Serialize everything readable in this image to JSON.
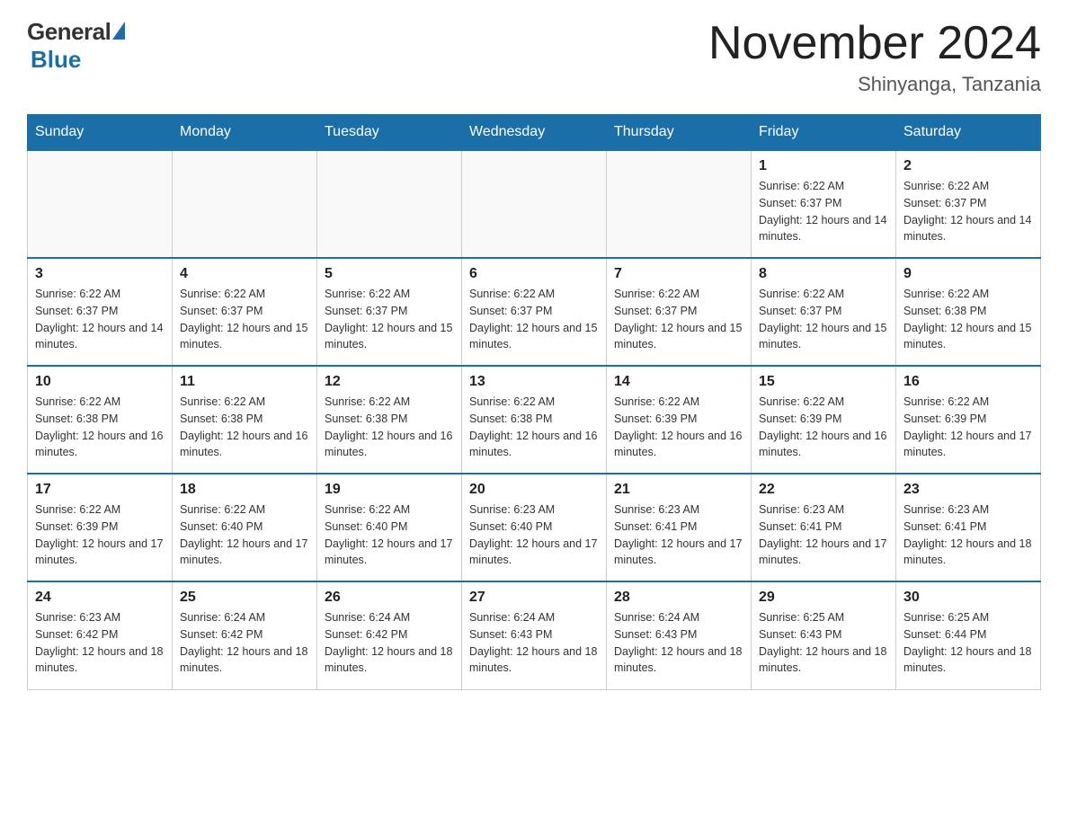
{
  "logo": {
    "general": "General",
    "blue": "Blue"
  },
  "title": {
    "month_year": "November 2024",
    "location": "Shinyanga, Tanzania"
  },
  "days_of_week": [
    "Sunday",
    "Monday",
    "Tuesday",
    "Wednesday",
    "Thursday",
    "Friday",
    "Saturday"
  ],
  "weeks": [
    [
      {
        "day": "",
        "info": ""
      },
      {
        "day": "",
        "info": ""
      },
      {
        "day": "",
        "info": ""
      },
      {
        "day": "",
        "info": ""
      },
      {
        "day": "",
        "info": ""
      },
      {
        "day": "1",
        "info": "Sunrise: 6:22 AM\nSunset: 6:37 PM\nDaylight: 12 hours and 14 minutes."
      },
      {
        "day": "2",
        "info": "Sunrise: 6:22 AM\nSunset: 6:37 PM\nDaylight: 12 hours and 14 minutes."
      }
    ],
    [
      {
        "day": "3",
        "info": "Sunrise: 6:22 AM\nSunset: 6:37 PM\nDaylight: 12 hours and 14 minutes."
      },
      {
        "day": "4",
        "info": "Sunrise: 6:22 AM\nSunset: 6:37 PM\nDaylight: 12 hours and 15 minutes."
      },
      {
        "day": "5",
        "info": "Sunrise: 6:22 AM\nSunset: 6:37 PM\nDaylight: 12 hours and 15 minutes."
      },
      {
        "day": "6",
        "info": "Sunrise: 6:22 AM\nSunset: 6:37 PM\nDaylight: 12 hours and 15 minutes."
      },
      {
        "day": "7",
        "info": "Sunrise: 6:22 AM\nSunset: 6:37 PM\nDaylight: 12 hours and 15 minutes."
      },
      {
        "day": "8",
        "info": "Sunrise: 6:22 AM\nSunset: 6:37 PM\nDaylight: 12 hours and 15 minutes."
      },
      {
        "day": "9",
        "info": "Sunrise: 6:22 AM\nSunset: 6:38 PM\nDaylight: 12 hours and 15 minutes."
      }
    ],
    [
      {
        "day": "10",
        "info": "Sunrise: 6:22 AM\nSunset: 6:38 PM\nDaylight: 12 hours and 16 minutes."
      },
      {
        "day": "11",
        "info": "Sunrise: 6:22 AM\nSunset: 6:38 PM\nDaylight: 12 hours and 16 minutes."
      },
      {
        "day": "12",
        "info": "Sunrise: 6:22 AM\nSunset: 6:38 PM\nDaylight: 12 hours and 16 minutes."
      },
      {
        "day": "13",
        "info": "Sunrise: 6:22 AM\nSunset: 6:38 PM\nDaylight: 12 hours and 16 minutes."
      },
      {
        "day": "14",
        "info": "Sunrise: 6:22 AM\nSunset: 6:39 PM\nDaylight: 12 hours and 16 minutes."
      },
      {
        "day": "15",
        "info": "Sunrise: 6:22 AM\nSunset: 6:39 PM\nDaylight: 12 hours and 16 minutes."
      },
      {
        "day": "16",
        "info": "Sunrise: 6:22 AM\nSunset: 6:39 PM\nDaylight: 12 hours and 17 minutes."
      }
    ],
    [
      {
        "day": "17",
        "info": "Sunrise: 6:22 AM\nSunset: 6:39 PM\nDaylight: 12 hours and 17 minutes."
      },
      {
        "day": "18",
        "info": "Sunrise: 6:22 AM\nSunset: 6:40 PM\nDaylight: 12 hours and 17 minutes."
      },
      {
        "day": "19",
        "info": "Sunrise: 6:22 AM\nSunset: 6:40 PM\nDaylight: 12 hours and 17 minutes."
      },
      {
        "day": "20",
        "info": "Sunrise: 6:23 AM\nSunset: 6:40 PM\nDaylight: 12 hours and 17 minutes."
      },
      {
        "day": "21",
        "info": "Sunrise: 6:23 AM\nSunset: 6:41 PM\nDaylight: 12 hours and 17 minutes."
      },
      {
        "day": "22",
        "info": "Sunrise: 6:23 AM\nSunset: 6:41 PM\nDaylight: 12 hours and 17 minutes."
      },
      {
        "day": "23",
        "info": "Sunrise: 6:23 AM\nSunset: 6:41 PM\nDaylight: 12 hours and 18 minutes."
      }
    ],
    [
      {
        "day": "24",
        "info": "Sunrise: 6:23 AM\nSunset: 6:42 PM\nDaylight: 12 hours and 18 minutes."
      },
      {
        "day": "25",
        "info": "Sunrise: 6:24 AM\nSunset: 6:42 PM\nDaylight: 12 hours and 18 minutes."
      },
      {
        "day": "26",
        "info": "Sunrise: 6:24 AM\nSunset: 6:42 PM\nDaylight: 12 hours and 18 minutes."
      },
      {
        "day": "27",
        "info": "Sunrise: 6:24 AM\nSunset: 6:43 PM\nDaylight: 12 hours and 18 minutes."
      },
      {
        "day": "28",
        "info": "Sunrise: 6:24 AM\nSunset: 6:43 PM\nDaylight: 12 hours and 18 minutes."
      },
      {
        "day": "29",
        "info": "Sunrise: 6:25 AM\nSunset: 6:43 PM\nDaylight: 12 hours and 18 minutes."
      },
      {
        "day": "30",
        "info": "Sunrise: 6:25 AM\nSunset: 6:44 PM\nDaylight: 12 hours and 18 minutes."
      }
    ]
  ]
}
